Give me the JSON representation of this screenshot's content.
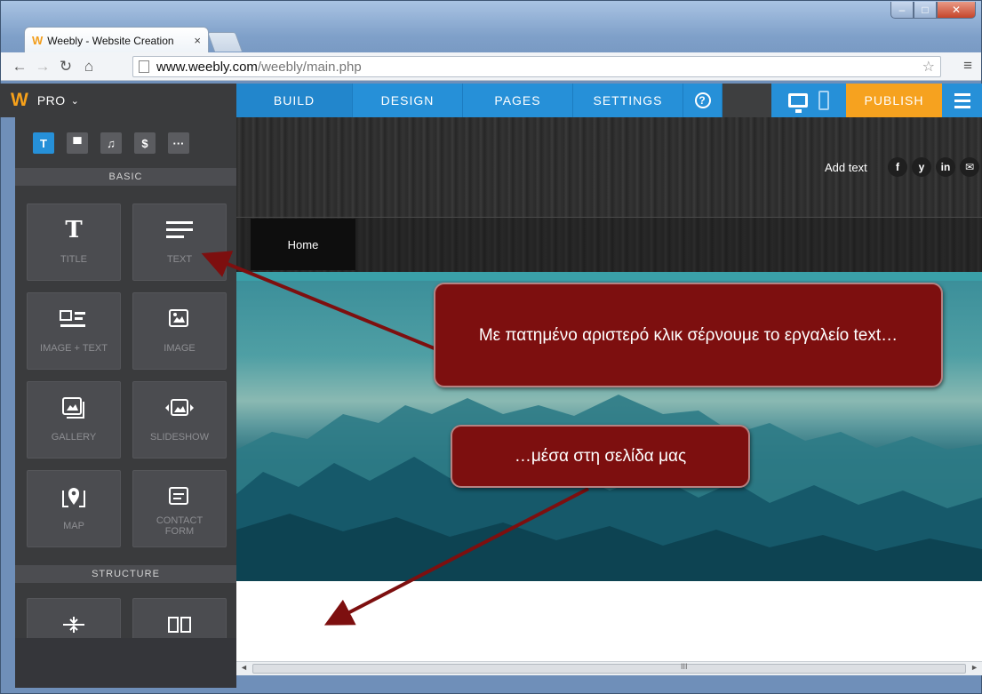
{
  "browser": {
    "tab_title": "Weebly - Website Creation",
    "tab_close": "×",
    "url_host": "www.weebly.com",
    "url_path": "/weebly/main.php"
  },
  "topbar": {
    "plan": "PRO",
    "nav": [
      {
        "label": "BUILD",
        "active": true
      },
      {
        "label": "DESIGN",
        "active": false
      },
      {
        "label": "PAGES",
        "active": false
      },
      {
        "label": "SETTINGS",
        "active": false
      }
    ],
    "help": "?",
    "publish": "PUBLISH"
  },
  "sidebar": {
    "categories": [
      {
        "glyph": "T",
        "icon": "text-category-icon"
      },
      {
        "glyph": "▀",
        "icon": "layout-category-icon"
      },
      {
        "glyph": "♫",
        "icon": "media-category-icon"
      },
      {
        "glyph": "$",
        "icon": "commerce-category-icon"
      },
      {
        "glyph": "···",
        "icon": "more-category-icon"
      }
    ],
    "basic_heading": "BASIC",
    "structure_heading": "STRUCTURE",
    "elements": [
      {
        "label": "TITLE",
        "icon": "title-icon"
      },
      {
        "label": "TEXT",
        "icon": "text-lines-icon"
      },
      {
        "label": "IMAGE + TEXT",
        "icon": "image-text-icon"
      },
      {
        "label": "IMAGE",
        "icon": "image-icon"
      },
      {
        "label": "GALLERY",
        "icon": "gallery-icon"
      },
      {
        "label": "SLIDESHOW",
        "icon": "slideshow-icon"
      },
      {
        "label": "MAP",
        "icon": "map-pin-icon"
      },
      {
        "label": "CONTACT FORM",
        "icon": "contact-form-icon"
      }
    ]
  },
  "site": {
    "add_text": "Add text",
    "social": [
      "f",
      "y",
      "in",
      "✉"
    ],
    "home": "Home"
  },
  "annotations": {
    "callout1": "Με πατημένο αριστερό κλικ σέρνουμε το εργαλείο text…",
    "callout2": "…μέσα στη σελίδα μας",
    "arrow_color": "#7d0f0f"
  },
  "scrollbar": {
    "grip": "III"
  }
}
